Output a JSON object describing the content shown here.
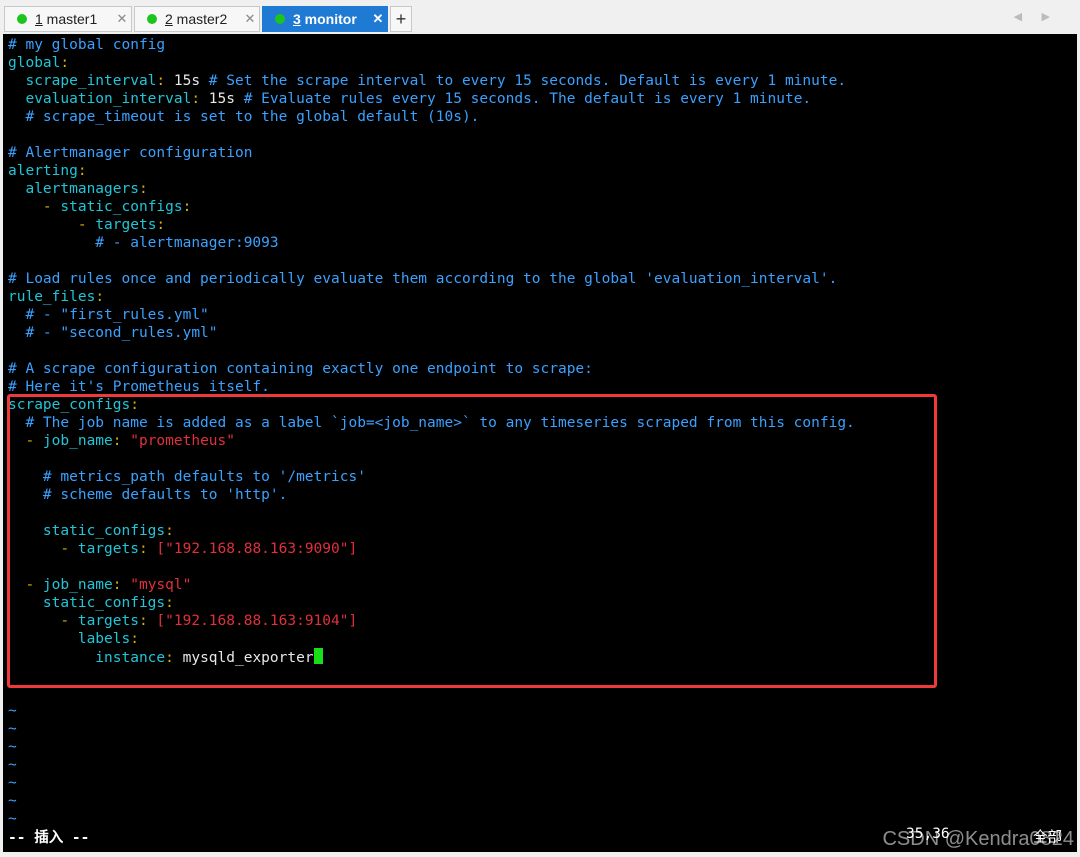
{
  "tabs": [
    {
      "num": "1",
      "name": " master1",
      "active": false
    },
    {
      "num": "2",
      "name": " master2",
      "active": false
    },
    {
      "num": "3",
      "name": " monitor",
      "active": true
    }
  ],
  "new_tab_label": "+",
  "close_glyph": "✕",
  "scroll_arrows": "◀ ▶",
  "lines": {
    "l0": "# my global config",
    "l1_key": "global",
    "l2_key": "  scrape_interval",
    "l2_val": " 15s",
    "l2_cmt": " # Set the scrape interval to every 15 seconds. Default is every 1 minute.",
    "l3_key": "  evaluation_interval",
    "l3_val": " 15s",
    "l3_cmt": " # Evaluate rules every 15 seconds. The default is every 1 minute.",
    "l4": "  # scrape_timeout is set to the global default (10s).",
    "l6": "# Alertmanager configuration",
    "l7_key": "alerting",
    "l8_key": "  alertmanagers",
    "l9_dash": "    - ",
    "l9_key": "static_configs",
    "l10_dash": "        - ",
    "l10_key": "targets",
    "l11": "          # - alertmanager:9093",
    "l13": "# Load rules once and periodically evaluate them according to the global 'evaluation_interval'.",
    "l14_key": "rule_files",
    "l15": "  # - \"first_rules.yml\"",
    "l16": "  # - \"second_rules.yml\"",
    "l18": "# A scrape configuration containing exactly one endpoint to scrape:",
    "l19": "# Here it's Prometheus itself.",
    "l20_key": "scrape_configs",
    "l21": "  # The job name is added as a label `job=<job_name>` to any timeseries scraped from this config.",
    "l22_dash": "  - ",
    "l22_key": "job_name",
    "l22_val": " \"prometheus\"",
    "l24": "    # metrics_path defaults to '/metrics'",
    "l25": "    # scheme defaults to 'http'.",
    "l27_key": "    static_configs",
    "l28_dash": "      - ",
    "l28_key": "targets",
    "l28_val": "[\"192.168.88.163:9090\"]",
    "l30_dash": "  - ",
    "l30_key": "job_name",
    "l30_val": " \"mysql\"",
    "l31_key": "    static_configs",
    "l32_dash": "      - ",
    "l32_key": "targets",
    "l32_val": "[\"192.168.88.163:9104\"]",
    "l33_key": "        labels",
    "l34_key": "          instance",
    "l34_val": " mysqld_exporter"
  },
  "colon": ":",
  "space_bracket": " ",
  "tilde": "~",
  "status_mode": "-- 插入 --",
  "cursor_pos": "35,36",
  "scroll_pct": "全部",
  "watermark": "CSDN @Kendra0824"
}
